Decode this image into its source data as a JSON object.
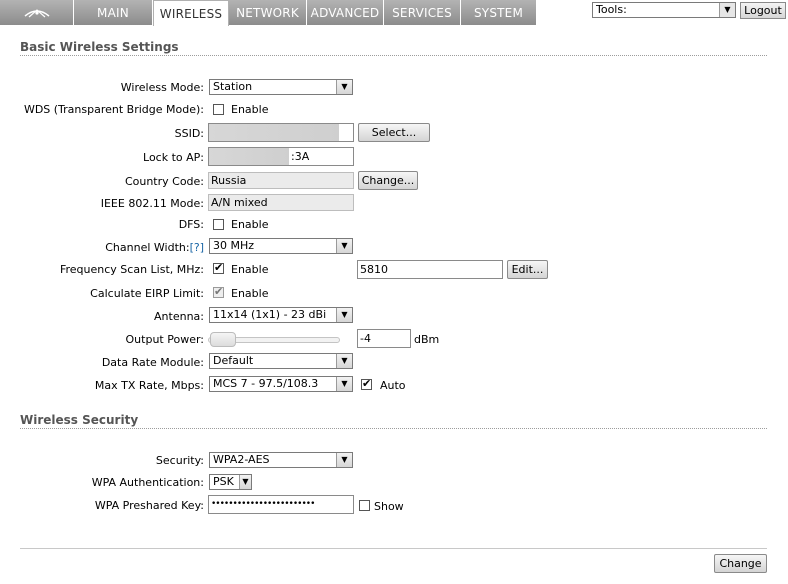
{
  "nav": {
    "tabs": [
      {
        "label": "MAIN",
        "active": false
      },
      {
        "label": "WIRELESS",
        "active": true
      },
      {
        "label": "NETWORK",
        "active": false
      },
      {
        "label": "ADVANCED",
        "active": false
      },
      {
        "label": "SERVICES",
        "active": false
      },
      {
        "label": "SYSTEM",
        "active": false
      }
    ],
    "tools_value": "Tools:",
    "logout_label": "Logout",
    "logo_icon": "ubiquiti-logo-icon"
  },
  "basic": {
    "title": "Basic Wireless Settings",
    "wireless_mode": {
      "label": "Wireless Mode:",
      "value": "Station"
    },
    "wds": {
      "label": "WDS (Transparent Bridge Mode):",
      "checkbox_label": "Enable",
      "checked": false
    },
    "ssid": {
      "label": "SSID:",
      "value": "",
      "button": "Select..."
    },
    "lock_to_ap": {
      "label": "Lock to AP:",
      "value": ":3A"
    },
    "country_code": {
      "label": "Country Code:",
      "value": "Russia",
      "button": "Change..."
    },
    "ieee_mode": {
      "label": "IEEE 802.11 Mode:",
      "value": "A/N mixed"
    },
    "dfs": {
      "label": "DFS:",
      "checkbox_label": "Enable",
      "checked": false
    },
    "channel_width": {
      "label": "Channel Width:",
      "help": "[?]",
      "value": "30 MHz"
    },
    "freq_scan": {
      "label": "Frequency Scan List, MHz:",
      "checkbox_label": "Enable",
      "checked": true,
      "value": "5810",
      "button": "Edit..."
    },
    "eirp": {
      "label": "Calculate EIRP Limit:",
      "checkbox_label": "Enable",
      "checked": true
    },
    "antenna": {
      "label": "Antenna:",
      "value": "11x14 (1x1) - 23 dBi"
    },
    "output_power": {
      "label": "Output Power:",
      "value": "-4",
      "unit": "dBm"
    },
    "data_rate_module": {
      "label": "Data Rate Module:",
      "value": "Default"
    },
    "max_tx_rate": {
      "label": "Max TX Rate, Mbps:",
      "value": "MCS 7 - 97.5/108.3",
      "auto_label": "Auto",
      "auto_checked": true
    }
  },
  "security": {
    "title": "Wireless Security",
    "security": {
      "label": "Security:",
      "value": "WPA2-AES"
    },
    "wpa_auth": {
      "label": "WPA Authentication:",
      "value": "PSK"
    },
    "psk": {
      "label": "WPA Preshared Key:",
      "value": "••••••••••••••••••••••••",
      "show_label": "Show",
      "show_checked": false
    }
  },
  "footer": {
    "change_button": "Change"
  }
}
